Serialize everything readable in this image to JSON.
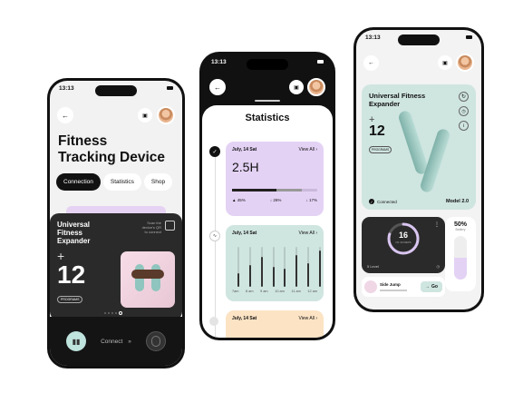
{
  "status": {
    "time": "13:13"
  },
  "phone1": {
    "title_line1": "Fitness",
    "title_line2": "Tracking Device",
    "tabs": [
      {
        "label": "Connection"
      },
      {
        "label": "Statistics"
      },
      {
        "label": "Shop"
      }
    ],
    "card": {
      "name_line1": "Universal",
      "name_line2": "Fitness",
      "name_line3": "Expander",
      "scan_text_line1": "Scan the",
      "scan_text_line2": "device's QR",
      "scan_text_line3": "to connect",
      "plus": "+",
      "count": "12",
      "count_label": "PROGRAMS"
    },
    "connect_label": "Connect",
    "connect_arrows": "»"
  },
  "phone2": {
    "title": "Statistics",
    "card1": {
      "date": "July, 14 Sat",
      "view_all": "View All",
      "value": "2.5H",
      "stats": [
        "▲ 45%",
        "↓ 26%",
        "↓ 17%"
      ]
    },
    "card2": {
      "date": "July, 14 Sat",
      "view_all": "View All",
      "ticks": [
        "7am",
        "8 am",
        "9 am",
        "10 am",
        "11 am",
        "12 am"
      ],
      "bar_values": [
        0.35,
        0.55,
        0.75,
        0.5,
        0.45,
        0.8,
        0.6,
        0.9
      ]
    },
    "card3": {
      "date": "July, 14 Sat",
      "view_all": "View All"
    }
  },
  "phone3": {
    "title_line1": "Universal Fitness",
    "title_line2": "Expander",
    "plus": "+",
    "count": "12",
    "count_label": "PROGRAMS",
    "connected": "Connected",
    "model": "Model 2.0",
    "ring_value": "16",
    "ring_label": "OF 20 REPS",
    "level": "5 Level",
    "percent": "50%",
    "percent_label": "Battery",
    "exercise": "Side Jump",
    "go": "Go",
    "colors": {
      "accent_lavender": "#d9c5f0",
      "mint": "#cfe5e0",
      "dark": "#2a2a2a"
    }
  }
}
